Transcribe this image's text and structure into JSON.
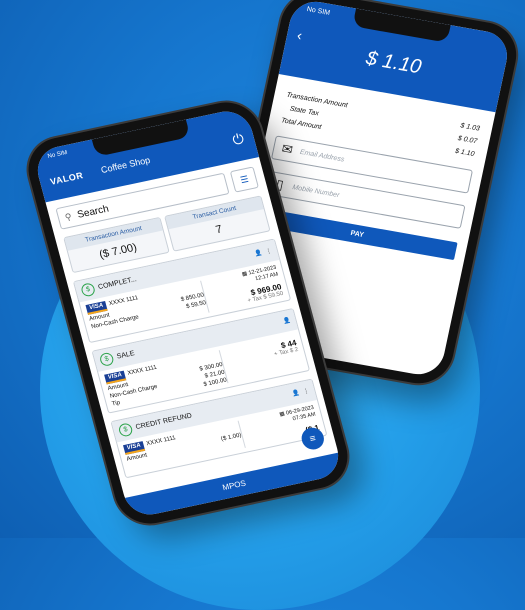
{
  "payment": {
    "status": "No SIM",
    "amount": "$ 1.10",
    "rows": [
      {
        "label": "Transaction Amount",
        "value": "$ 1.03"
      },
      {
        "label": "State Tax",
        "value": "$ 0.07"
      },
      {
        "label": "Total Amount",
        "value": "$ 1.10"
      }
    ],
    "email_placeholder": "Email Address",
    "mobile_placeholder": "Mobile Number",
    "pay_label": "PAY"
  },
  "list": {
    "status": "No SIM",
    "logo": "VALOR",
    "shop": "Coffee Shop",
    "search_label": "Search",
    "stat_amount_title": "Transaction Amount",
    "stat_amount_value": "($ 7.00)",
    "stat_count_title": "Transact Count",
    "stat_count_value": "7",
    "cards": [
      {
        "title": "COMPLET...",
        "date": "12-21-2023",
        "time": "12:17 AM",
        "card": "XXXX 1111",
        "amount_label": "Amount",
        "amount": "$ 850.00",
        "ncc_label": "Non-Cash Charge",
        "ncc": "$ 59.50",
        "total": "$ 969.00",
        "tax": "+ Tax $ 59.50"
      },
      {
        "title": "SALE",
        "card": "XXXX 1111",
        "amount_label": "Amount",
        "amount": "$ 300.00",
        "ncc_label": "Non-Cash Charge",
        "ncc": "$ 21.00",
        "tip_label": "Tip",
        "tip": "$ 100.00",
        "total": "$ 44",
        "tax": "+ Tax $ 2"
      },
      {
        "title": "CREDIT REFUND",
        "date": "06-29-2023",
        "time": "07:35 AM",
        "card": "XXXX 1111",
        "amount_label": "Amount",
        "amount": "($ 1.00)",
        "total": "($ 1"
      }
    ],
    "bottom_label": "MPOS"
  }
}
